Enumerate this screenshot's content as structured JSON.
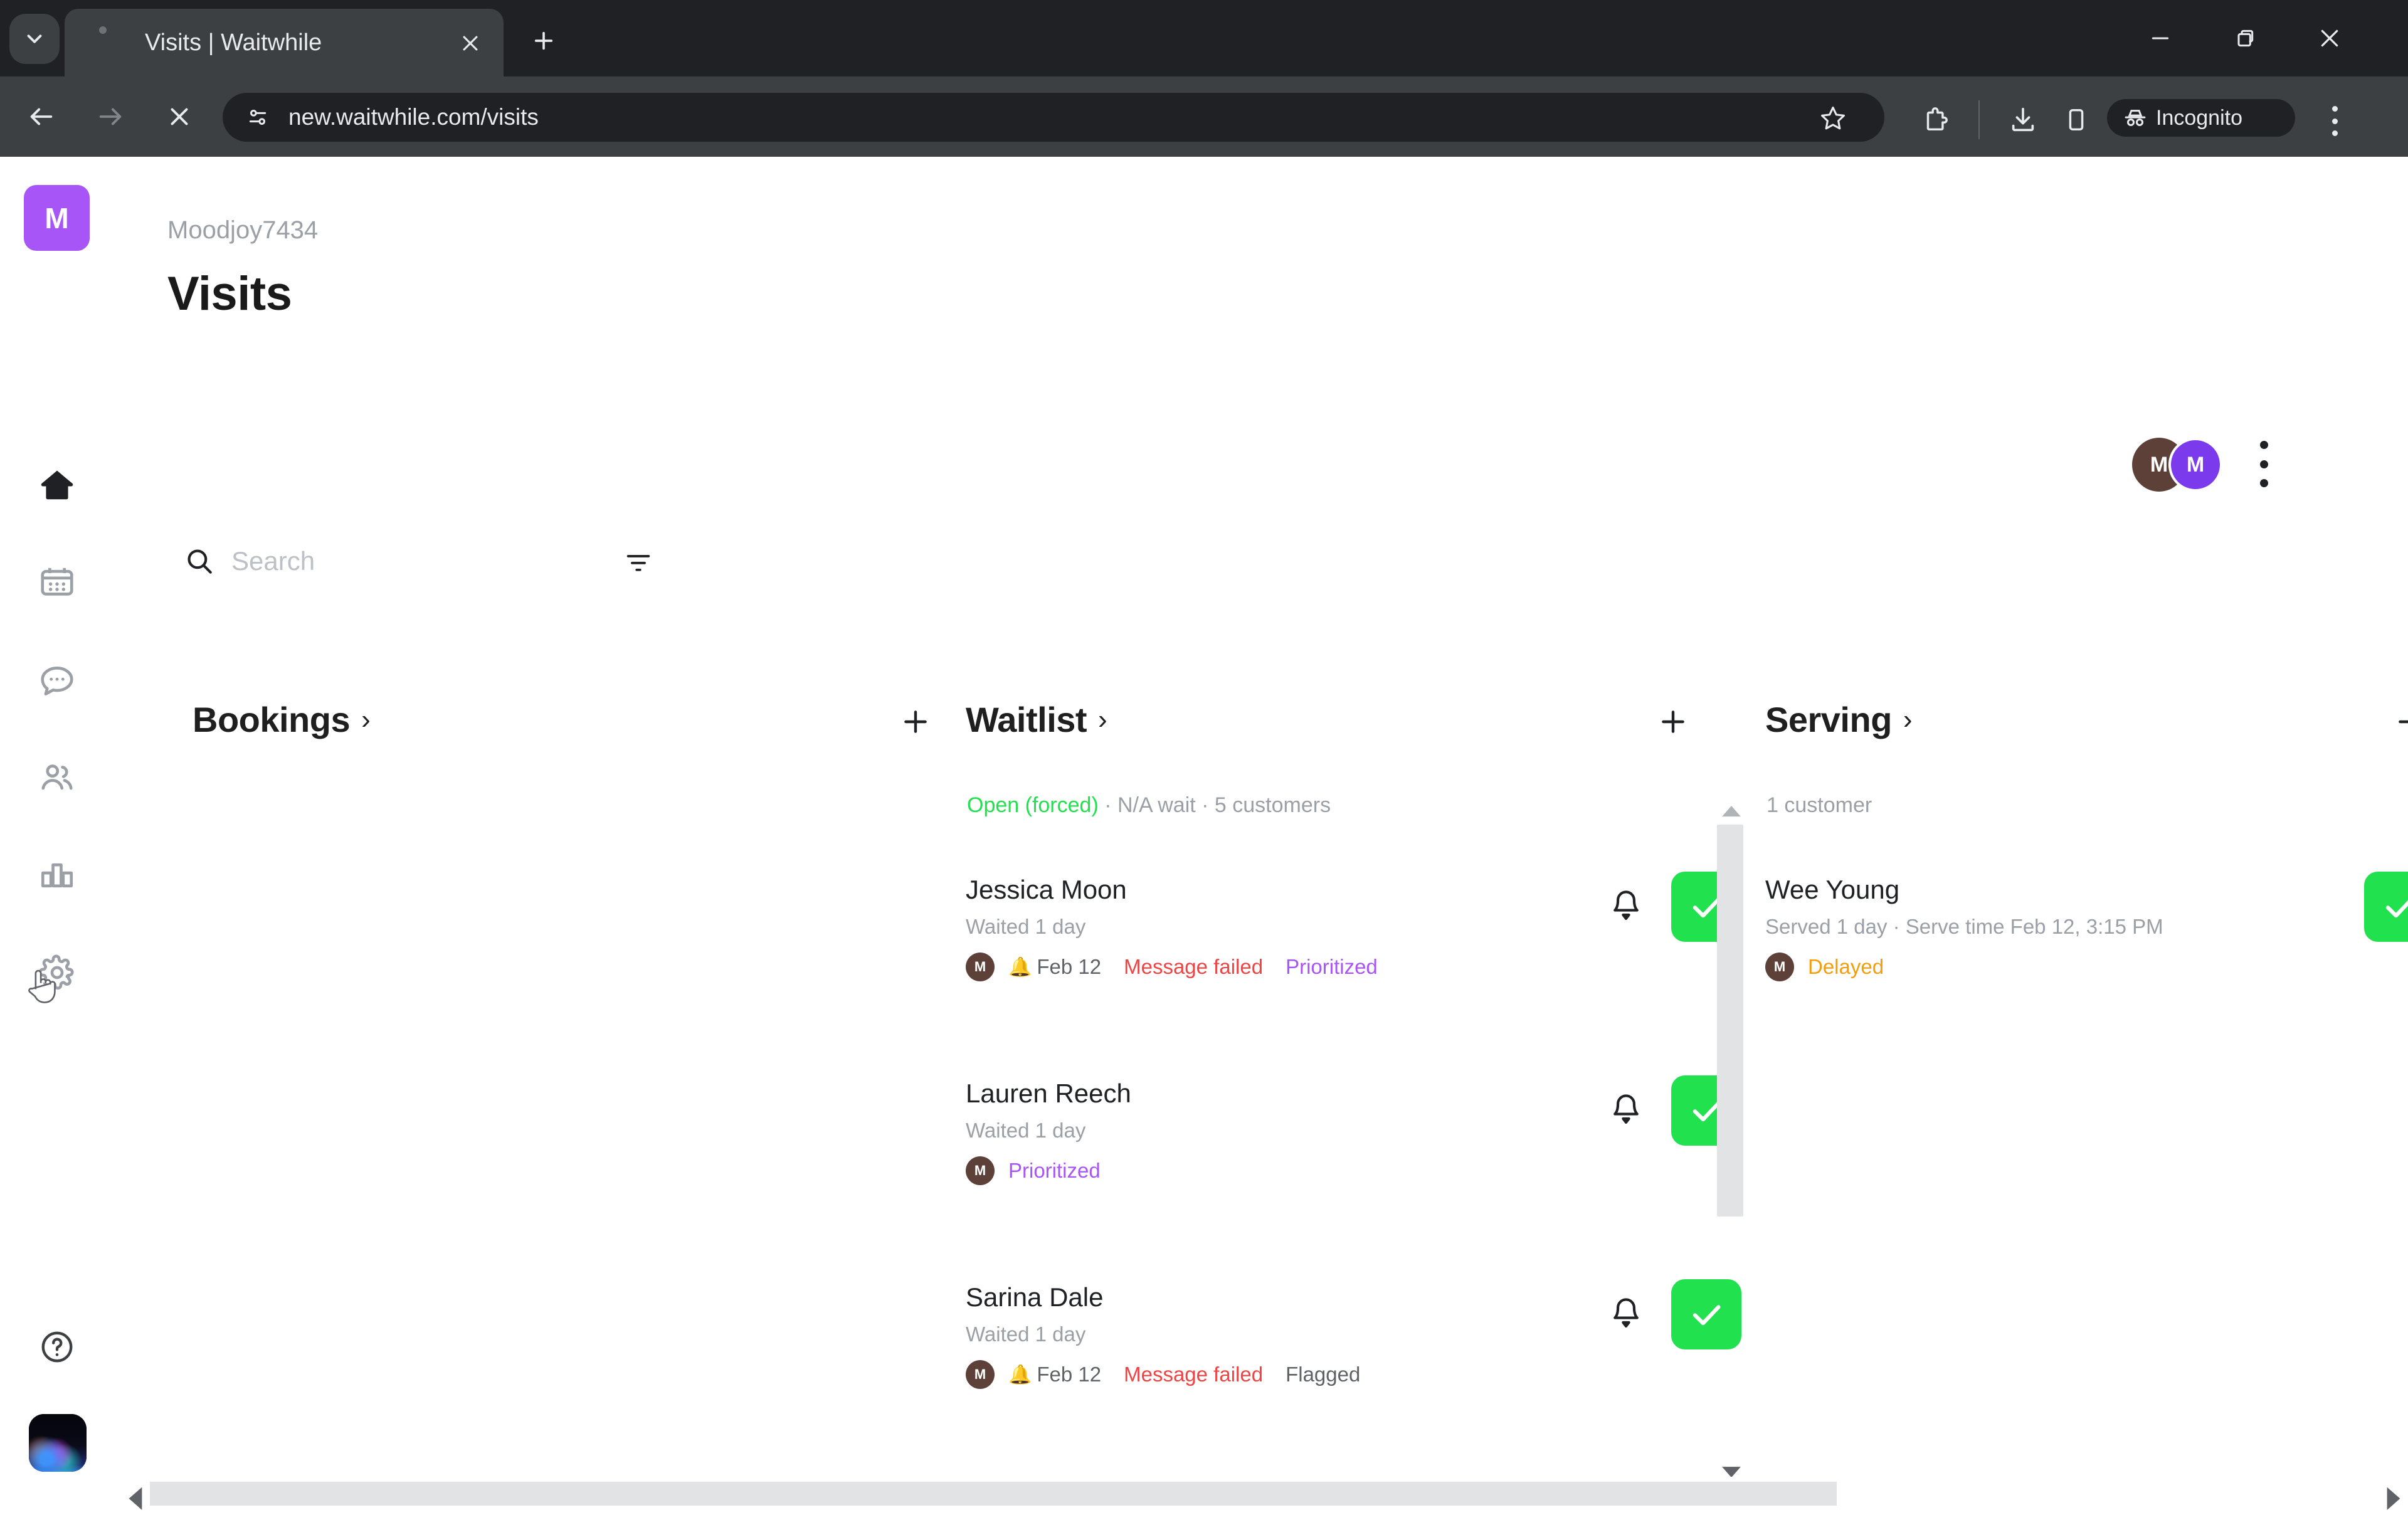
{
  "browser": {
    "tab_title": "Visits | Waitwhile",
    "url": "new.waitwhile.com/visits",
    "profile_label": "Incognito",
    "icons": {
      "tab_search": "chevron-down-icon",
      "tab_close": "close-icon",
      "new_tab": "plus-icon",
      "back": "back-arrow-icon",
      "forward": "forward-arrow-icon",
      "stop": "stop-loading-icon",
      "site_info": "site-settings-icon",
      "bookmark": "star-icon",
      "extensions": "extensions-icon",
      "downloads": "download-icon",
      "side_panel": "side-panel-icon",
      "incognito": "incognito-icon",
      "menu": "kebab-menu-icon",
      "minimize": "minimize-icon",
      "maximize": "maximize-icon",
      "close": "window-close-icon"
    }
  },
  "sidebar": {
    "logo_initial": "M",
    "items": [
      {
        "name": "home",
        "label": "Home",
        "icon": "home-icon",
        "active": true
      },
      {
        "name": "calendar",
        "label": "Calendar",
        "icon": "calendar-icon",
        "active": false
      },
      {
        "name": "messages",
        "label": "Messages",
        "icon": "chat-bubble-icon",
        "active": false
      },
      {
        "name": "customers",
        "label": "Customers",
        "icon": "people-icon",
        "active": false
      },
      {
        "name": "analytics",
        "label": "Analytics",
        "icon": "bar-chart-icon",
        "active": false
      },
      {
        "name": "settings",
        "label": "Settings",
        "icon": "gear-icon",
        "active": false
      }
    ],
    "help_icon": "help-circle-icon",
    "avatar_icon": "user-photo-avatar"
  },
  "header": {
    "org_name": "Moodjoy7434",
    "page_title": "Visits",
    "avatars": [
      {
        "initial": "M",
        "color": "#5d4037"
      },
      {
        "initial": "M",
        "color": "#7c3aed"
      }
    ],
    "menu_icon": "kebab-menu-icon"
  },
  "search": {
    "placeholder": "Search",
    "value": "",
    "search_icon": "search-icon",
    "filter_icon": "filter-icon"
  },
  "columns": [
    {
      "id": "bookings",
      "title": "Bookings",
      "chevron": "›",
      "add_icon": "plus-icon",
      "meta": "",
      "cards": []
    },
    {
      "id": "waitlist",
      "title": "Waitlist",
      "chevron": "›",
      "add_icon": "plus-icon",
      "meta_status": "Open (forced)",
      "meta_rest": " · N/A wait · 5 customers",
      "cards": [
        {
          "name": "Jessica Moon",
          "sub": "Waited 1 day",
          "avatar_initial": "M",
          "bell": "🔔",
          "date": "Feb 12",
          "status_failed": "Message failed",
          "status_tag": "Prioritized",
          "status_tag_kind": "prioritized",
          "bell_icon": "bell-icon",
          "check_icon": "check-icon"
        },
        {
          "name": "Lauren Reech",
          "sub": "Waited 1 day",
          "avatar_initial": "M",
          "bell": "",
          "date": "",
          "status_failed": "",
          "status_tag": "Prioritized",
          "status_tag_kind": "prioritized",
          "bell_icon": "bell-icon",
          "check_icon": "check-icon"
        },
        {
          "name": "Sarina Dale",
          "sub": "Waited 1 day",
          "avatar_initial": "M",
          "bell": "🔔",
          "date": "Feb 12",
          "status_failed": "Message failed",
          "status_tag": "Flagged",
          "status_tag_kind": "flagged",
          "bell_icon": "bell-icon",
          "check_icon": "check-icon"
        }
      ]
    },
    {
      "id": "serving",
      "title": "Serving",
      "chevron": "›",
      "add_icon": "plus-icon",
      "meta": "1 customer",
      "cards": [
        {
          "name": "Wee Young",
          "sub": "Served 1 day · Serve time Feb 12, 3:15 PM",
          "avatar_initial": "M",
          "status_tag": "Delayed",
          "status_tag_kind": "delayed",
          "check_icon": "check-icon"
        }
      ]
    }
  ],
  "scrollbars": {
    "waitlist_up_icon": "scroll-up-arrow-icon",
    "waitlist_down_icon": "scroll-down-arrow-icon",
    "horizontal_left_icon": "scroll-left-arrow-icon",
    "horizontal_right_icon": "scroll-right-arrow-icon"
  },
  "colors": {
    "brand_purple": "#a855f7",
    "accent_green": "#22e14f",
    "error_red": "#ef4444",
    "warning_orange": "#f59e0b",
    "muted_gray": "#9aa0a6"
  }
}
